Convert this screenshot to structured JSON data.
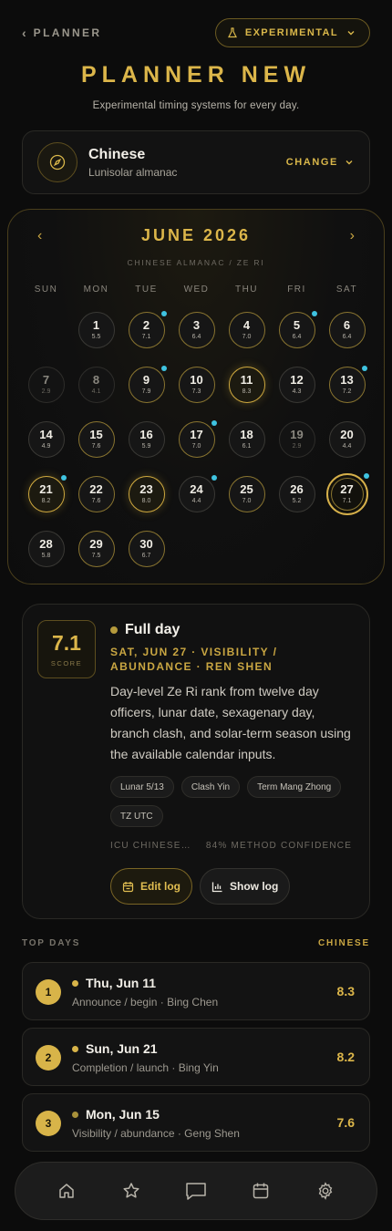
{
  "header": {
    "back_label": "PLANNER",
    "badge_label": "EXPERIMENTAL",
    "title": "PLANNER NEW",
    "subtitle": "Experimental timing systems for every day."
  },
  "system": {
    "name": "Chinese",
    "description": "Lunisolar almanac",
    "change_label": "CHANGE"
  },
  "calendar": {
    "month": "JUNE 2026",
    "subtitle": "CHINESE ALMANAC / ZE RI",
    "weekdays": [
      "SUN",
      "MON",
      "TUE",
      "WED",
      "THU",
      "FRI",
      "SAT"
    ],
    "days": [
      {
        "d": "1",
        "s": "5.5",
        "tone": "normal",
        "dot": false
      },
      {
        "d": "2",
        "s": "7.1",
        "tone": "mid",
        "dot": true
      },
      {
        "d": "3",
        "s": "6.4",
        "tone": "mid",
        "dot": false
      },
      {
        "d": "4",
        "s": "7.0",
        "tone": "mid",
        "dot": false
      },
      {
        "d": "5",
        "s": "6.4",
        "tone": "mid",
        "dot": true
      },
      {
        "d": "6",
        "s": "6.4",
        "tone": "mid",
        "dot": false
      },
      {
        "d": "7",
        "s": "2.9",
        "tone": "low",
        "dot": false
      },
      {
        "d": "8",
        "s": "4.1",
        "tone": "low",
        "dot": false
      },
      {
        "d": "9",
        "s": "7.9",
        "tone": "mid",
        "dot": true
      },
      {
        "d": "10",
        "s": "7.3",
        "tone": "mid",
        "dot": false
      },
      {
        "d": "11",
        "s": "8.3",
        "tone": "high",
        "dot": false
      },
      {
        "d": "12",
        "s": "4.3",
        "tone": "normal",
        "dot": false
      },
      {
        "d": "13",
        "s": "7.2",
        "tone": "mid",
        "dot": true
      },
      {
        "d": "14",
        "s": "4.9",
        "tone": "normal",
        "dot": false
      },
      {
        "d": "15",
        "s": "7.6",
        "tone": "mid",
        "dot": false
      },
      {
        "d": "16",
        "s": "5.9",
        "tone": "normal",
        "dot": false
      },
      {
        "d": "17",
        "s": "7.0",
        "tone": "mid",
        "dot": true
      },
      {
        "d": "18",
        "s": "6.1",
        "tone": "normal",
        "dot": false
      },
      {
        "d": "19",
        "s": "2.9",
        "tone": "low",
        "dot": false
      },
      {
        "d": "20",
        "s": "4.4",
        "tone": "normal",
        "dot": false
      },
      {
        "d": "21",
        "s": "8.2",
        "tone": "high",
        "dot": true
      },
      {
        "d": "22",
        "s": "7.6",
        "tone": "mid",
        "dot": false
      },
      {
        "d": "23",
        "s": "8.0",
        "tone": "high",
        "dot": false
      },
      {
        "d": "24",
        "s": "4.4",
        "tone": "normal",
        "dot": true
      },
      {
        "d": "25",
        "s": "7.0",
        "tone": "mid",
        "dot": false
      },
      {
        "d": "26",
        "s": "5.2",
        "tone": "normal",
        "dot": false
      },
      {
        "d": "27",
        "s": "7.1",
        "tone": "sel",
        "dot": true
      },
      {
        "d": "28",
        "s": "5.8",
        "tone": "normal",
        "dot": false
      },
      {
        "d": "29",
        "s": "7.5",
        "tone": "mid",
        "dot": false
      },
      {
        "d": "30",
        "s": "6.7",
        "tone": "mid",
        "dot": false
      }
    ]
  },
  "detail": {
    "score": "7.1",
    "score_label": "SCORE",
    "title": "Full day",
    "meta": "SAT, JUN 27 · VISIBILITY / ABUNDANCE · REN SHEN",
    "description": "Day-level Ze Ri rank from twelve day officers, lunar date, sexagenary day, branch clash, and solar-term season using the available calendar inputs.",
    "chips": [
      "Lunar 5/13",
      "Clash Yin",
      "Term Mang Zhong",
      "TZ UTC"
    ],
    "method": "ICU CHINESE…",
    "confidence": "84% METHOD CONFIDENCE",
    "edit_label": "Edit log",
    "show_label": "Show log"
  },
  "top_days": {
    "label": "TOP DAYS",
    "system": "CHINESE",
    "items": [
      {
        "rank": "1",
        "date": "Thu, Jun 11",
        "sub": "Announce / begin · Bing Chen",
        "score": "8.3"
      },
      {
        "rank": "2",
        "date": "Sun, Jun 21",
        "sub": "Completion / launch · Bing Yin",
        "score": "8.2"
      },
      {
        "rank": "3",
        "date": "Mon, Jun 15",
        "sub": "Visibility / abundance · Geng Shen",
        "score": "7.6"
      }
    ]
  },
  "nav": [
    "home-icon",
    "star-icon",
    "chat-icon",
    "calendar-icon",
    "settings-icon"
  ],
  "colors": {
    "accent": "#d9b74a",
    "dot": "#3fc3e0",
    "background": "#0c0c0c"
  }
}
